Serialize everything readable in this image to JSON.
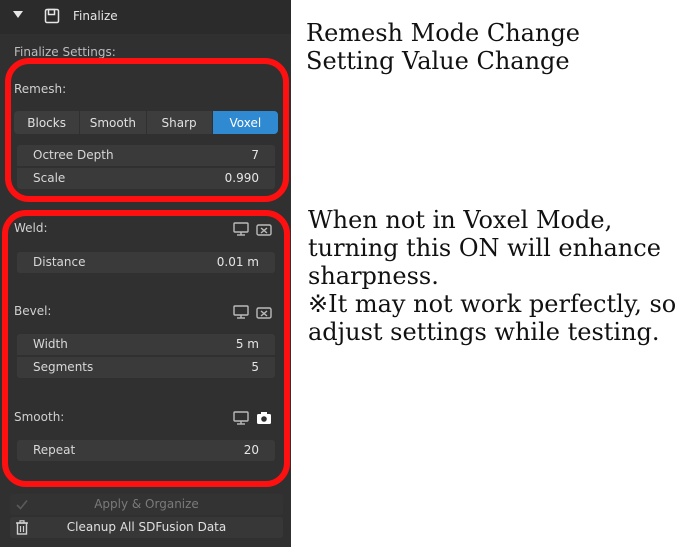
{
  "panel": {
    "title": "Finalize",
    "settings_label": "Finalize Settings:",
    "remesh": {
      "label": "Remesh:",
      "modes": [
        "Blocks",
        "Smooth",
        "Sharp",
        "Voxel"
      ],
      "active_mode": "Voxel",
      "fields": [
        {
          "label": "Octree Depth",
          "value": "7"
        },
        {
          "label": "Scale",
          "value": "0.990"
        }
      ]
    },
    "weld": {
      "label": "Weld:",
      "fields": [
        {
          "label": "Distance",
          "value": "0.01 m"
        }
      ]
    },
    "bevel": {
      "label": "Bevel:",
      "fields": [
        {
          "label": "Width",
          "value": "5 m"
        },
        {
          "label": "Segments",
          "value": "5"
        }
      ]
    },
    "smooth": {
      "label": "Smooth:",
      "fields": [
        {
          "label": "Repeat",
          "value": "20"
        }
      ]
    },
    "apply_button": "Apply & Organize",
    "cleanup_button": "Cleanup All SDFusion Data"
  },
  "annotations": {
    "note1": "Remesh Mode Change\nSetting Value Change",
    "note2": "When not in Voxel Mode,\nturning this ON will enhance\nsharpness.\n※It may not work perfectly, so\nadjust settings while testing."
  },
  "colors": {
    "panel_bg": "#303030",
    "active_accent": "#2f8ad1",
    "annotation_red": "#ff1010"
  }
}
